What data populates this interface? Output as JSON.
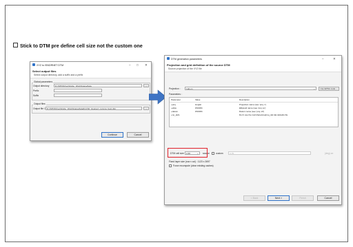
{
  "slide": {
    "bullet_text": "Stick to DTM pre define cell size  not the custom one"
  },
  "left_window": {
    "title": "XYZ to ISNDRNET DTM",
    "header_title": "Select output files",
    "header_subtitle": "Select output directory, add a suffix and a prefix",
    "general_group_label": "Global parameters",
    "output_dir_label": "Output directory",
    "output_dir_value": "D:/ISHOD/net/Globe_WorkSpace/data",
    "prefix_label": "Prefix",
    "suffix_label": "Suffix",
    "output_files_group_label": "Output files",
    "output_file_label": "Output file 1",
    "output_file_value": "D:/ISHOD/net/Globe_WorkSpace/data/for15d_cleaned_comma_best.dtm",
    "browse_label": "...",
    "continue_label": "Continue",
    "cancel_label": "Cancel"
  },
  "right_window": {
    "title": "DTM generation parameters",
    "header_title": "Projection and grid definition of the source DTM",
    "header_subtitle": "Source projection of the XYZ file",
    "projection_label": "Projection :",
    "projection_value": "LatLon",
    "use_epsg_label": "Use EPSG code ...",
    "parameters_label": "Parameters :",
    "columns": [
      "Parameter",
      "Value",
      "Description"
    ],
    "rows": [
      [
        "+proj",
        "longlat",
        "Projection name (see 'proj -l')"
      ],
      [
        "+ellps",
        "WGS84",
        "Ellipsoid name (see 'proj -le')"
      ],
      [
        "+datum",
        "WGS84",
        "Datum name (see 'proj -ld')"
      ],
      [
        "+no_defs",
        "",
        "Don't use the /usr/share/proj/proj_def.dat defaults file"
      ]
    ],
    "cell_size_label": "DTM cell size",
    "cell_size_value": "1/16",
    "source_label": "source",
    "custom_label": "custom",
    "custom_value": "3.75",
    "unit_label": "(deg) on",
    "layer_size_text": "Fixed layer size (row x col) : 1123 x 2697",
    "force_recompute_label": "Force recompute (clear existing caches)",
    "back_label": "< Back",
    "next_label": "Next >",
    "finish_label": "Finish",
    "cancel_label": "Cancel"
  },
  "colors": {
    "arrow": "#3e74c4",
    "highlight": "#e0202a",
    "accent": "#2f72c8"
  }
}
